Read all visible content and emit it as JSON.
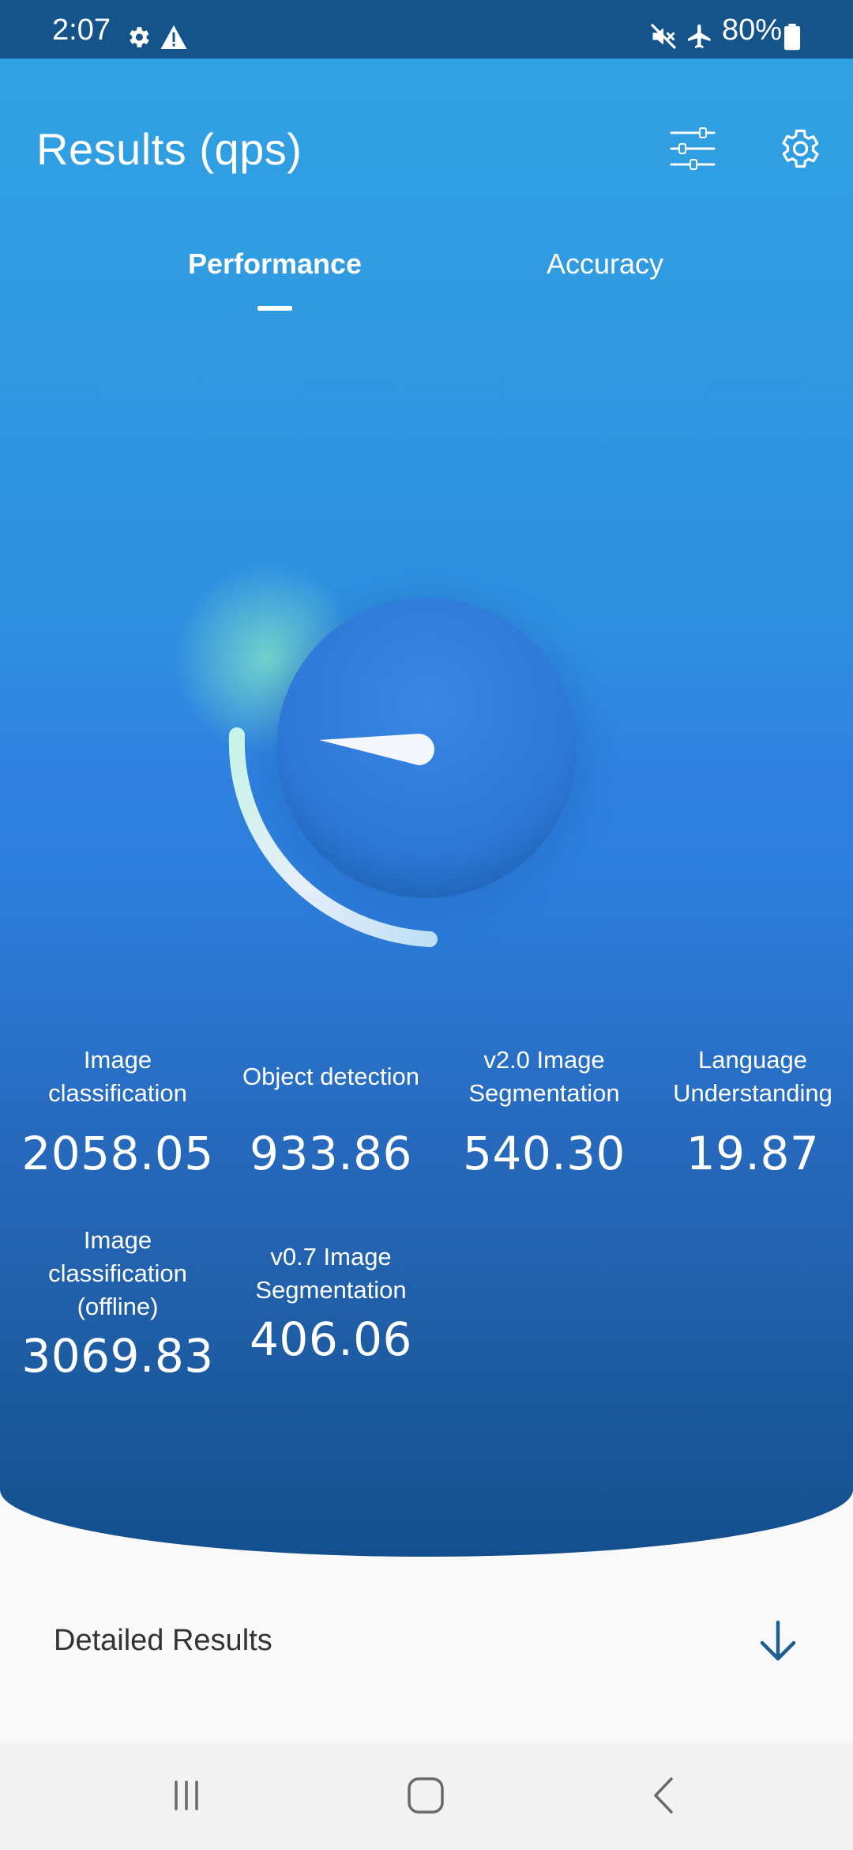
{
  "status_bar": {
    "time": "2:07",
    "battery_percent": "80%",
    "left_icons": [
      "gear-icon",
      "warning-icon"
    ],
    "right_icons": [
      "mute-icon",
      "airplane-icon",
      "battery-icon"
    ]
  },
  "header": {
    "title": "Results (qps)",
    "icons": [
      "sliders-icon",
      "gear-icon"
    ]
  },
  "tabs": [
    {
      "label": "Performance",
      "selected": true
    },
    {
      "label": "Accuracy",
      "selected": false
    }
  ],
  "metrics": [
    {
      "label": "Image classification",
      "value": "2058.05"
    },
    {
      "label": "Object detection",
      "value": "933.86"
    },
    {
      "label": "v2.0 Image Segmentation",
      "value": "540.30"
    },
    {
      "label": "Language Understanding",
      "value": "19.87"
    },
    {
      "label": "Image classification (offline)",
      "value": "3069.83"
    },
    {
      "label": "v0.7 Image Segmentation",
      "value": "406.06"
    }
  ],
  "detailed_results": {
    "label": "Detailed Results",
    "icon": "arrow-down-icon"
  },
  "nav_bar": {
    "icons": [
      "recents-icon",
      "home-icon",
      "back-icon"
    ]
  },
  "colors": {
    "status_bar": "#15548b",
    "hero_top": "#30a2e2",
    "hero_bottom": "#134f8c",
    "arrow": "#1c5f8e",
    "background": "#f9f9f9"
  }
}
